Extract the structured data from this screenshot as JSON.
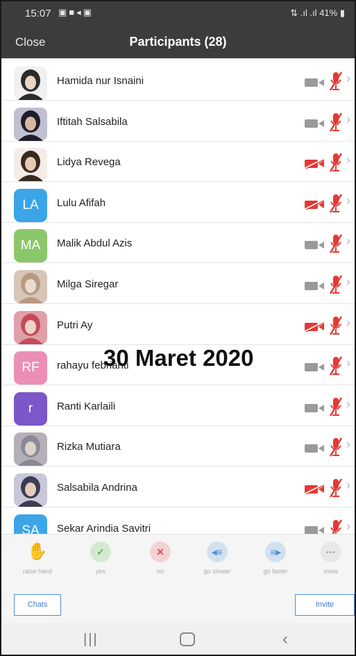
{
  "status_bar": {
    "time": "15:07",
    "battery": "41%"
  },
  "header": {
    "close_label": "Close",
    "title": "Participants (28)"
  },
  "participants": [
    {
      "name": "Hamida nur Isnaini",
      "avatar_type": "photo",
      "camera": "on"
    },
    {
      "name": "Iftitah Salsabila",
      "avatar_type": "photo",
      "camera": "on"
    },
    {
      "name": "Lidya Revega",
      "avatar_type": "photo",
      "camera": "off"
    },
    {
      "name": "Lulu Afifah",
      "avatar_type": "initials",
      "initials": "LA",
      "color": "#3ba5e8",
      "camera": "off"
    },
    {
      "name": "Malik Abdul Azis",
      "avatar_type": "initials",
      "initials": "MA",
      "color": "#8cc66b",
      "camera": "on"
    },
    {
      "name": "Milga Siregar",
      "avatar_type": "photo",
      "camera": "on"
    },
    {
      "name": "Putri Ay",
      "avatar_type": "photo",
      "camera": "off"
    },
    {
      "name": "rahayu febrianti",
      "avatar_type": "initials",
      "initials": "RF",
      "color": "#ec8fb7",
      "camera": "on"
    },
    {
      "name": "Ranti Karlaili",
      "avatar_type": "initials",
      "initials": "r",
      "color": "#7b57c9",
      "camera": "on"
    },
    {
      "name": "Rizka Mutiara",
      "avatar_type": "photo",
      "camera": "on"
    },
    {
      "name": "Salsabila Andrina",
      "avatar_type": "photo",
      "camera": "off"
    },
    {
      "name": "Sekar Arindia Savitri",
      "avatar_type": "initials",
      "initials": "SA",
      "color": "#3ba5e8",
      "camera": "on"
    }
  ],
  "overlay": {
    "date": "30 Maret 2020"
  },
  "reactions": [
    {
      "label": "raise hand",
      "icon": "hand-icon",
      "color": "#f7c08a"
    },
    {
      "label": "yes",
      "icon": "check-icon",
      "color": "#54b848"
    },
    {
      "label": "no",
      "icon": "x-icon",
      "color": "#e24a4a"
    },
    {
      "label": "go slower",
      "icon": "rewind-icon",
      "color": "#4a8fd9"
    },
    {
      "label": "go faster",
      "icon": "fast-forward-icon",
      "color": "#4a8fd9"
    },
    {
      "label": "more",
      "icon": "more-icon",
      "color": "#888888"
    }
  ],
  "actions": {
    "chats_label": "Chats",
    "invite_label": "Invite"
  },
  "colors": {
    "header_bg": "#3c3c3c",
    "muted_red": "#e53935",
    "camera_gray": "#9a9a9a",
    "accent_blue": "#4a90d9"
  }
}
